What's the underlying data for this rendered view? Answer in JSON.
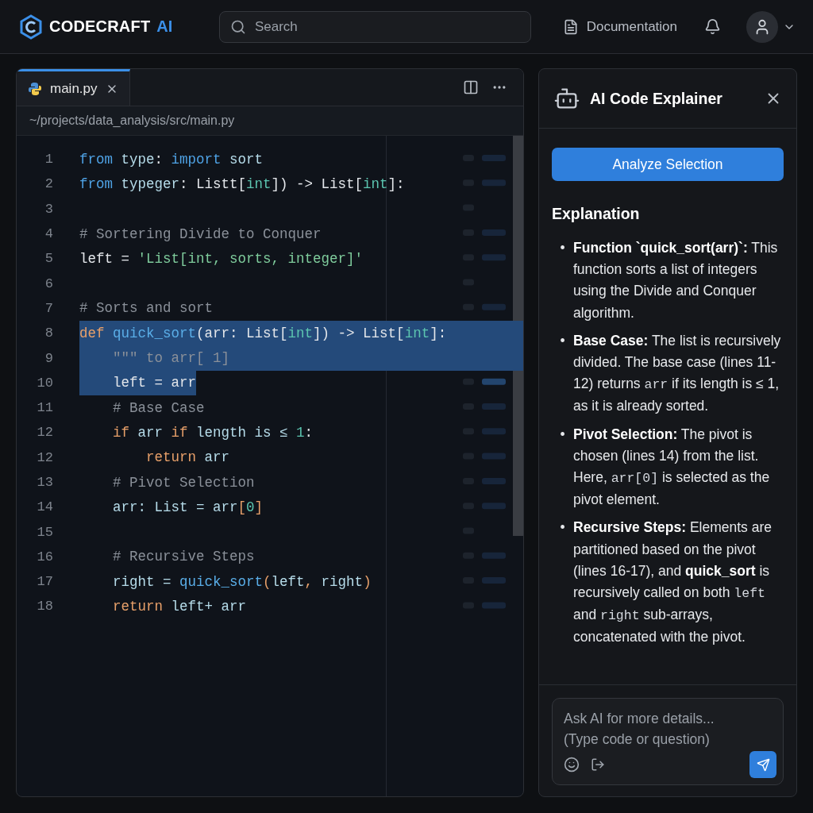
{
  "header": {
    "brand": "CODECRAFT",
    "brand_accent": "AI",
    "search": {
      "placeholder": "Search"
    },
    "documentation": "Documentation"
  },
  "editor": {
    "tabs": [
      {
        "label": "main.py",
        "selected": true
      }
    ],
    "breadcrumb": "~/projects/data_analysis/src/main.py",
    "lines": [
      {
        "number": "1",
        "selected": false,
        "tokens": [
          {
            "text": "from",
            "kind": "kw"
          },
          {
            "text": " type",
            "kind": "name"
          },
          {
            "text": ": ",
            "kind": "plain"
          },
          {
            "text": "import",
            "kind": "kw"
          },
          {
            "text": " sort",
            "kind": "name"
          }
        ]
      },
      {
        "number": "2",
        "selected": false,
        "tokens": [
          {
            "text": "from",
            "kind": "kw"
          },
          {
            "text": " typeger",
            "kind": "name"
          },
          {
            "text": ": Listt[",
            "kind": "plain"
          },
          {
            "text": "int",
            "kind": "num"
          },
          {
            "text": "]) -> List[",
            "kind": "plain"
          },
          {
            "text": "int",
            "kind": "num"
          },
          {
            "text": "]:",
            "kind": "plain"
          }
        ]
      },
      {
        "number": "3",
        "selected": false
      },
      {
        "number": "4",
        "selected": false,
        "tokens": [
          {
            "text": "# Sortering Divide to Conquer",
            "kind": "comment"
          }
        ]
      },
      {
        "number": "5",
        "selected": false,
        "tokens": [
          {
            "text": "left = ",
            "kind": "plain"
          },
          {
            "text": "'List[int, sorts, integer]'",
            "kind": "str"
          }
        ]
      },
      {
        "number": "6",
        "selected": false
      },
      {
        "number": "7",
        "selected": false,
        "tokens": [
          {
            "text": "# Sorts and sort",
            "kind": "comment"
          }
        ]
      },
      {
        "number": "8",
        "selected": true,
        "tokens": [
          {
            "text": "def",
            "kind": "ctl"
          },
          {
            "text": " quick_sort",
            "kind": "fn"
          },
          {
            "text": "(arr: List[",
            "kind": "plain"
          },
          {
            "text": "int",
            "kind": "num"
          },
          {
            "text": "]) -> List[",
            "kind": "plain"
          },
          {
            "text": "int",
            "kind": "num"
          },
          {
            "text": "]:",
            "kind": "plain"
          }
        ]
      },
      {
        "number": "9",
        "selected": true,
        "tokens": [
          {
            "text": "    \"\"\" to arr[ 1]",
            "kind": "comment"
          }
        ]
      },
      {
        "number": "10",
        "selected": true,
        "tokens": [
          {
            "text": "    left = arr",
            "kind": "plain"
          }
        ]
      },
      {
        "number": "11",
        "selected": false,
        "tokens": [
          {
            "text": "    # Base Case",
            "kind": "comment"
          }
        ]
      },
      {
        "number": "12",
        "selected": false,
        "tokens": [
          {
            "text": "    if",
            "kind": "ctl"
          },
          {
            "text": " arr ",
            "kind": "name"
          },
          {
            "text": "if",
            "kind": "ctl"
          },
          {
            "text": " length is ≤ ",
            "kind": "name"
          },
          {
            "text": "1",
            "kind": "num"
          },
          {
            "text": ":",
            "kind": "plain"
          }
        ]
      },
      {
        "number": "12",
        "selected": false,
        "tokens": [
          {
            "text": "        return",
            "kind": "ctl"
          },
          {
            "text": " arr",
            "kind": "name"
          }
        ]
      },
      {
        "number": "13",
        "selected": false,
        "tokens": [
          {
            "text": "    # Pivot Selection",
            "kind": "comment"
          }
        ]
      },
      {
        "number": "14",
        "selected": false,
        "tokens": [
          {
            "text": "    arr: List = arr",
            "kind": "name"
          },
          {
            "text": "[",
            "kind": "ctl"
          },
          {
            "text": "0",
            "kind": "num"
          },
          {
            "text": "]",
            "kind": "ctl"
          }
        ]
      },
      {
        "number": "15",
        "selected": false
      },
      {
        "number": "16",
        "selected": false,
        "tokens": [
          {
            "text": "    # Recursive Steps",
            "kind": "comment"
          }
        ]
      },
      {
        "number": "17",
        "selected": false,
        "tokens": [
          {
            "text": "    right = ",
            "kind": "name"
          },
          {
            "text": "quick_sort",
            "kind": "fn"
          },
          {
            "text": "(",
            "kind": "ctl"
          },
          {
            "text": "left",
            "kind": "name"
          },
          {
            "text": ", ",
            "kind": "ctl"
          },
          {
            "text": "right",
            "kind": "name"
          },
          {
            "text": ")",
            "kind": "ctl"
          }
        ]
      },
      {
        "number": "18",
        "selected": false,
        "tokens": [
          {
            "text": "    return",
            "kind": "ctl"
          },
          {
            "text": " left+ arr",
            "kind": "name"
          }
        ]
      }
    ]
  },
  "assistant": {
    "title": "AI Code Explainer",
    "analyze_button": "Analyze Selection",
    "heading": "Explanation",
    "items": [
      {
        "bullet": "•",
        "parts": [
          {
            "text": "Function `quick_sort(arr)`:",
            "kind": "bold"
          },
          {
            "text": " This function sorts a list of integers using the Divide and Conquer algorithm.",
            "kind": "plain"
          }
        ]
      },
      {
        "bullet": "•",
        "parts": [
          {
            "text": "Base Case:",
            "kind": "bold"
          },
          {
            "text": " The list is recursively divided. The base case (lines 11-12) returns ",
            "kind": "plain"
          },
          {
            "text": "arr",
            "kind": "code"
          },
          {
            "text": " if its length is ≤ 1, as it is already sorted.",
            "kind": "plain"
          }
        ]
      },
      {
        "bullet": "•",
        "parts": [
          {
            "text": "Pivot Selection:",
            "kind": "bold"
          },
          {
            "text": " The pivot is chosen (lines 14) from the list. Here, ",
            "kind": "plain"
          },
          {
            "text": "arr[0]",
            "kind": "code"
          },
          {
            "text": " is selected as the pivot element.",
            "kind": "plain"
          }
        ]
      },
      {
        "bullet": "•",
        "parts": [
          {
            "text": "Recursive Steps:",
            "kind": "bold"
          },
          {
            "text": " Elements are partitioned based on the pivot (lines 16-17), and ",
            "kind": "plain"
          },
          {
            "text": "quick_sort",
            "kind": "bold"
          },
          {
            "text": " is recursively called on both ",
            "kind": "plain"
          },
          {
            "text": "left",
            "kind": "code"
          },
          {
            "text": " and ",
            "kind": "plain"
          },
          {
            "text": "right",
            "kind": "code"
          },
          {
            "text": " sub-arrays, concatenated with the pivot.",
            "kind": "plain"
          }
        ]
      }
    ],
    "input": {
      "placeholder": "Ask AI for more details...\n(Type code or question)"
    }
  }
}
